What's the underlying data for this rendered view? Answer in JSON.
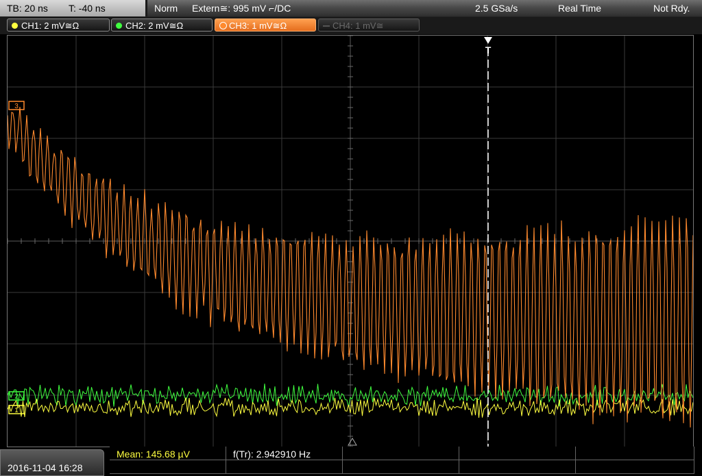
{
  "header": {
    "timebase": "TB: 20 ns",
    "trigger_time": "T: -40 ns",
    "trigger_mode": "Norm",
    "trigger_source": "Extern≅: 995 mV ⌐/DC",
    "sample_rate": "2.5 GSa/s",
    "acq_mode": "Real Time",
    "status": "Not Rdy."
  },
  "channels": [
    {
      "label": "CH1: 2 mV≅Ω",
      "color": "#ffff40",
      "state": "on"
    },
    {
      "label": "CH2: 2 mV≅Ω",
      "color": "#40ff40",
      "state": "on"
    },
    {
      "label": "CH3: 1 mV≅Ω",
      "color": "#ff8a2e",
      "state": "active"
    },
    {
      "label": "CH4: 1 mV≅",
      "color": "#6a6a6a",
      "state": "off"
    }
  ],
  "screen": {
    "trigger_marker": "T",
    "ch3_marker": "3",
    "ch2_marker": "2",
    "ch1_marker": "1"
  },
  "footer": {
    "datetime": "2016-11-04 16:28",
    "measurement_1": "Mean: 145.68 µV",
    "measurement_2": "f(Tr): 2.942910 Hz"
  },
  "colors": {
    "ch1": "#ffff40",
    "ch2": "#40ff40",
    "ch3": "#ff8a2e",
    "grid": "#3a3a3a"
  }
}
